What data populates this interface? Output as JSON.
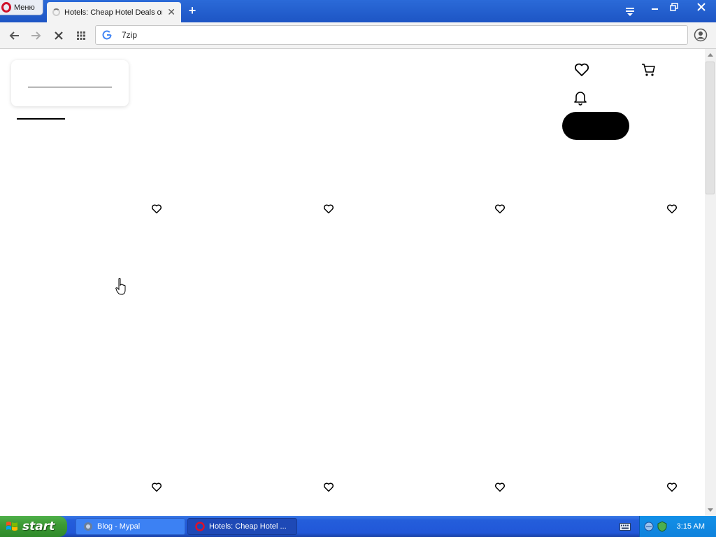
{
  "browser": {
    "menu_label": "Меню",
    "tab_title": "Hotels: Cheap Hotel Deals on",
    "address": "7zip",
    "new_tab_symbol": "+",
    "tab_close_symbol": "✕"
  },
  "page": {
    "header_icons": [
      "heart-icon",
      "cart-icon",
      "bell-icon"
    ],
    "favorite_icon": "heart-outline-icon"
  },
  "taskbar": {
    "start_label": "start",
    "tasks": [
      {
        "label": "Blog - Mypal",
        "active": false
      },
      {
        "label": "Hotels: Cheap Hotel ...",
        "active": true
      }
    ],
    "clock": "3:15 AM"
  },
  "colors": {
    "titlebar": "#2b6ad8",
    "taskbar": "#245edb",
    "start": "#3c9a35",
    "opera_red": "#d0112b",
    "pill": "#000000"
  }
}
